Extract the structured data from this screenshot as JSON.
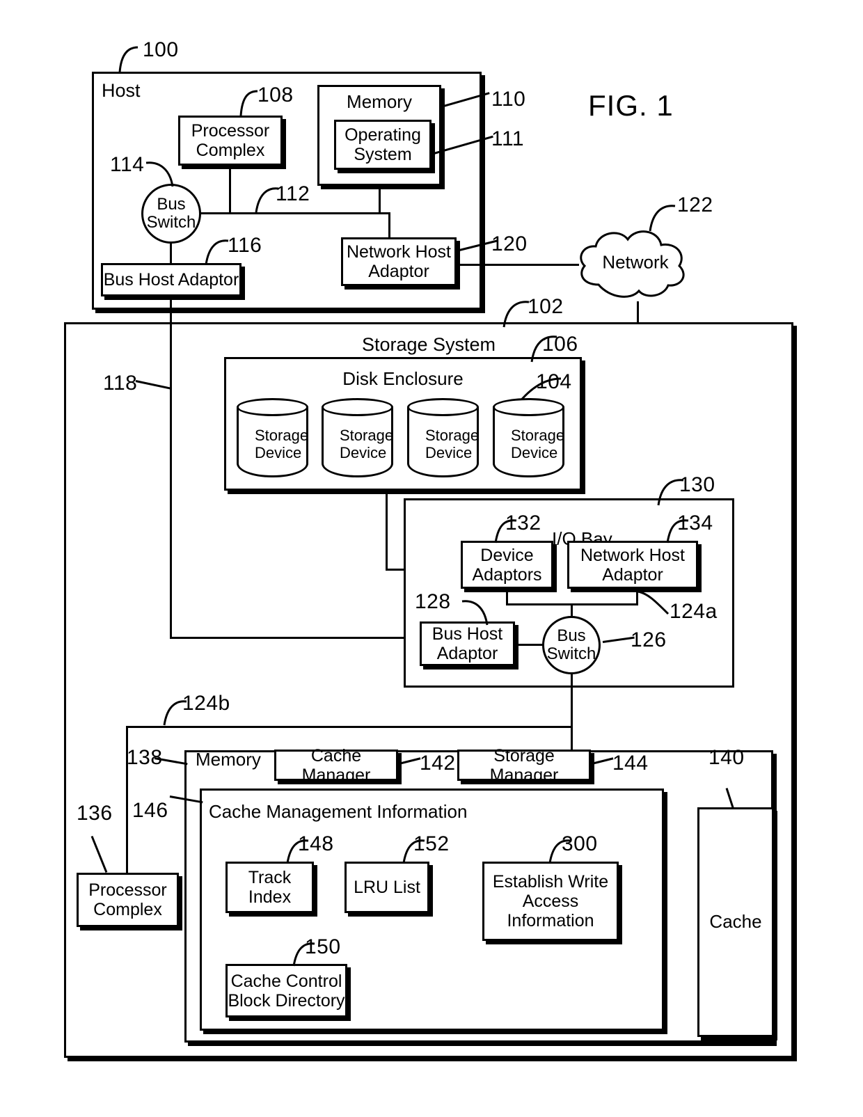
{
  "figure": {
    "title": "FIG. 1",
    "type": "patent-block-diagram"
  },
  "host": {
    "label": "Host",
    "ref": "100",
    "processor_complex": {
      "label": "Processor Complex",
      "ref": "108"
    },
    "memory": {
      "label": "Memory",
      "ref": "110"
    },
    "operating_system": {
      "label": "Operating System",
      "ref": "111"
    },
    "bus_switch": {
      "label": "Bus Switch",
      "ref": "114"
    },
    "bus_host_adaptor": {
      "label": "Bus Host Adaptor",
      "ref": "116"
    },
    "network_host_adaptor": {
      "label": "Network Host Adaptor",
      "ref": "120"
    },
    "bus_ref": "112"
  },
  "network": {
    "label": "Network",
    "ref": "122"
  },
  "storage_system": {
    "label": "Storage System",
    "ref": "102",
    "bus_ref": "118",
    "disk_enclosure": {
      "label": "Disk Enclosure",
      "ref": "106"
    },
    "storage_device_ref": "104",
    "storage_devices": [
      {
        "label": "Storage Device"
      },
      {
        "label": "Storage Device"
      },
      {
        "label": "Storage Device"
      },
      {
        "label": "Storage Device"
      }
    ],
    "io_bay": {
      "label": "I/O Bay",
      "ref": "130",
      "device_adaptors": {
        "label": "Device Adaptors",
        "ref": "132"
      },
      "network_host_adaptor": {
        "label": "Network Host Adaptor",
        "ref": "134"
      },
      "bus_host_adaptor": {
        "label": "Bus Host Adaptor",
        "ref": "128"
      },
      "bus_switch": {
        "label": "Bus Switch",
        "ref": "126"
      },
      "bus_ref": "124a"
    },
    "bus_ref_b": "124b",
    "processor_complex": {
      "label": "Processor Complex",
      "ref": "136"
    },
    "memory": {
      "label": "Memory",
      "ref": "138",
      "cache_manager": {
        "label": "Cache Manager",
        "ref": "142"
      },
      "storage_manager": {
        "label": "Storage Manager",
        "ref": "144"
      },
      "cache": {
        "label": "Cache",
        "ref": "140"
      },
      "cache_management_information": {
        "label": "Cache Management Information",
        "ref": "146",
        "items": [
          {
            "label": "Track Index",
            "ref": "148"
          },
          {
            "label": "LRU List",
            "ref": "152"
          },
          {
            "label": "Establish Write Access Information",
            "ref": "300"
          },
          {
            "label": "Cache Control Block Directory",
            "ref": "150"
          }
        ]
      }
    }
  },
  "colors": {
    "ink": "#000000",
    "paper": "#ffffff"
  }
}
